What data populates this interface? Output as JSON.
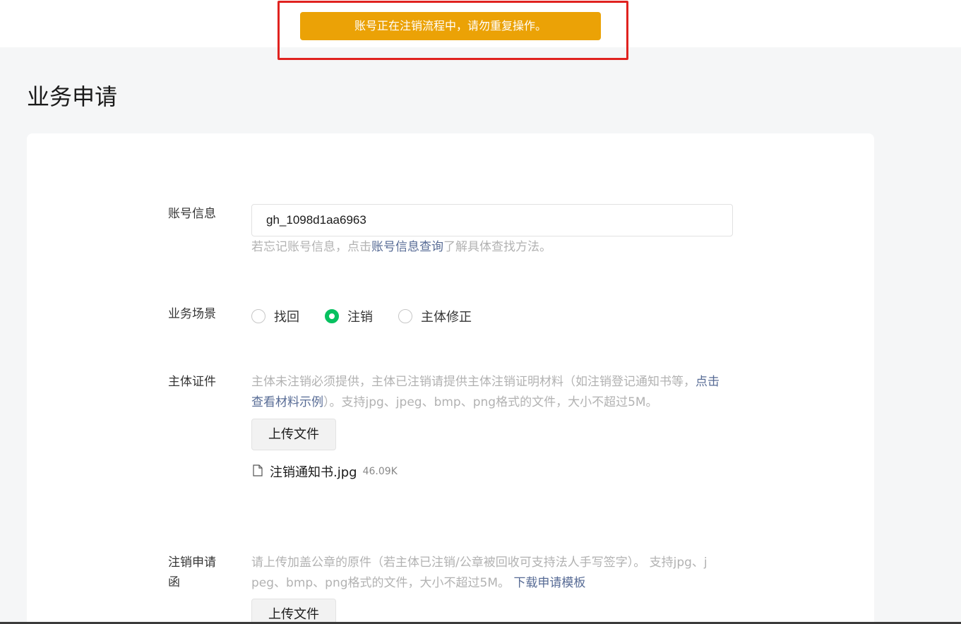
{
  "toast": {
    "message": "账号正在注销流程中，请勿重复操作。"
  },
  "page": {
    "title": "业务申请"
  },
  "form": {
    "account": {
      "label": "账号信息",
      "value": "gh_1098d1aa6963",
      "tip_prefix": "若忘记账号信息，点击",
      "tip_link": "账号信息查询",
      "tip_suffix": "了解具体查找方法。"
    },
    "scenario": {
      "label": "业务场景",
      "options": [
        {
          "label": "找回",
          "checked": false
        },
        {
          "label": "注销",
          "checked": true
        },
        {
          "label": "主体修正",
          "checked": false
        }
      ]
    },
    "certificate": {
      "label": "主体证件",
      "tip_line1_prefix": "主体未注销必须提供，主体已注销请提供主体注销证明材料（如注销登记通知书等，",
      "tip_line1_link": "点击",
      "tip_line2_link": "查看材料示例",
      "tip_line2_suffix": "）。支持jpg、jpeg、bmp、png格式的文件，大小不超过5M。",
      "upload_label": "上传文件",
      "file_name": "注销通知书.jpg",
      "file_size": "46.09K"
    },
    "letter": {
      "label_line1": "注销申请",
      "label_line2": "函",
      "tip_line1": "请上传加盖公章的原件（若主体已注销/公章被回收可支持法人手写签字）。 支持jpg、j",
      "tip_line2_prefix": "peg、bmp、png格式的文件，大小不超过5M。",
      "tip_link": "下载申请模板",
      "upload_label": "上传文件"
    }
  }
}
